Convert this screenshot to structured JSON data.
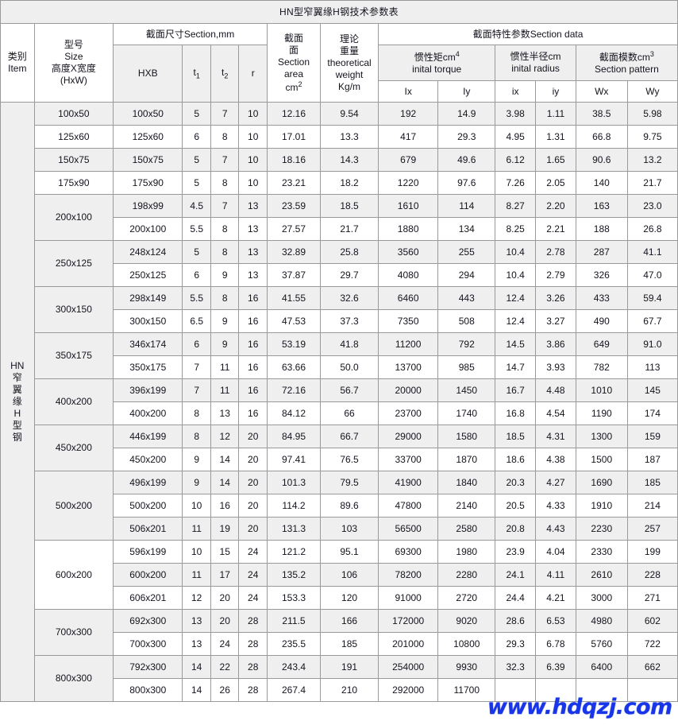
{
  "title": "HN型窄翼缘H钢技术参数表",
  "watermark": "www.hdqzj.com",
  "header": {
    "item": {
      "cn": "类别",
      "en": "Item"
    },
    "size": {
      "l1": "型号",
      "l2": "Size",
      "l3": "高度X宽度",
      "l4": "(HxW)"
    },
    "section_dim": "截面尺寸Section,mm",
    "hxb": "HXB",
    "t1": "t",
    "t1_sub": "1",
    "t2": "t",
    "t2_sub": "2",
    "r": "r",
    "section_area": {
      "l1": "截面",
      "l2": "面",
      "l3": "Section",
      "l4": "area",
      "l5": "cm",
      "sup": "2"
    },
    "theoretical_weight": {
      "l1": "理论",
      "l2": "重量",
      "l3": "theoretical",
      "l4": "weight",
      "l5": "Kg/m"
    },
    "section_data": "截面特性参数Section data",
    "inertia_torque": {
      "cn": "惯性矩cm",
      "sup": "4",
      "en": "inital torque"
    },
    "inertia_radius": {
      "cn": "惯性半径cm",
      "en": "inital radius"
    },
    "section_pattern": {
      "cn": "截面模数cm",
      "sup": "3",
      "en": "Section pattern"
    },
    "ix_moment": "Ix",
    "iy_moment": "Iy",
    "ix_radius": "ix",
    "iy_radius": "iy",
    "wx": "Wx",
    "wy": "Wy"
  },
  "category_label": [
    "HN",
    "窄",
    "翼",
    "缘",
    "H",
    "型",
    "钢"
  ],
  "colors": {
    "weight_red": "#e8112d",
    "header_gray": "#efefef",
    "border": "#9a9a9a",
    "watermark_blue": "#1835e8"
  },
  "groups": [
    {
      "size": "100x50",
      "rows": [
        {
          "hxb": "100x50",
          "t1": "5",
          "t2": "7",
          "r": "10",
          "area": "12.16",
          "weight": "9.54",
          "Ix": "192",
          "Iy": "14.9",
          "ix": "3.98",
          "iy": "1.11",
          "Wx": "38.5",
          "Wy": "5.98",
          "shade": "gray"
        }
      ]
    },
    {
      "size": "125x60",
      "rows": [
        {
          "hxb": "125x60",
          "t1": "6",
          "t2": "8",
          "r": "10",
          "area": "17.01",
          "weight": "13.3",
          "Ix": "417",
          "Iy": "29.3",
          "ix": "4.95",
          "iy": "1.31",
          "Wx": "66.8",
          "Wy": "9.75",
          "shade": "white"
        }
      ]
    },
    {
      "size": "150x75",
      "rows": [
        {
          "hxb": "150x75",
          "t1": "5",
          "t2": "7",
          "r": "10",
          "area": "18.16",
          "weight": "14.3",
          "Ix": "679",
          "Iy": "49.6",
          "ix": "6.12",
          "iy": "1.65",
          "Wx": "90.6",
          "Wy": "13.2",
          "shade": "gray"
        }
      ]
    },
    {
      "size": "175x90",
      "rows": [
        {
          "hxb": "175x90",
          "t1": "5",
          "t2": "8",
          "r": "10",
          "area": "23.21",
          "weight": "18.2",
          "Ix": "1220",
          "Iy": "97.6",
          "ix": "7.26",
          "iy": "2.05",
          "Wx": "140",
          "Wy": "21.7",
          "shade": "white"
        }
      ]
    },
    {
      "size": "200x100",
      "rows": [
        {
          "hxb": "198x99",
          "t1": "4.5",
          "t2": "7",
          "r": "13",
          "area": "23.59",
          "weight": "18.5",
          "Ix": "1610",
          "Iy": "114",
          "ix": "8.27",
          "iy": "2.20",
          "Wx": "163",
          "Wy": "23.0",
          "shade": "gray"
        },
        {
          "hxb": "200x100",
          "t1": "5.5",
          "t2": "8",
          "r": "13",
          "area": "27.57",
          "weight": "21.7",
          "Ix": "1880",
          "Iy": "134",
          "ix": "8.25",
          "iy": "2.21",
          "Wx": "188",
          "Wy": "26.8",
          "shade": "white"
        }
      ]
    },
    {
      "size": "250x125",
      "rows": [
        {
          "hxb": "248x124",
          "t1": "5",
          "t2": "8",
          "r": "13",
          "area": "32.89",
          "weight": "25.8",
          "Ix": "3560",
          "Iy": "255",
          "ix": "10.4",
          "iy": "2.78",
          "Wx": "287",
          "Wy": "41.1",
          "shade": "gray"
        },
        {
          "hxb": "250x125",
          "t1": "6",
          "t2": "9",
          "r": "13",
          "area": "37.87",
          "weight": "29.7",
          "Ix": "4080",
          "Iy": "294",
          "ix": "10.4",
          "iy": "2.79",
          "Wx": "326",
          "Wy": "47.0",
          "shade": "white"
        }
      ]
    },
    {
      "size": "300x150",
      "rows": [
        {
          "hxb": "298x149",
          "t1": "5.5",
          "t2": "8",
          "r": "16",
          "area": "41.55",
          "weight": "32.6",
          "Ix": "6460",
          "Iy": "443",
          "ix": "12.4",
          "iy": "3.26",
          "Wx": "433",
          "Wy": "59.4",
          "shade": "gray"
        },
        {
          "hxb": "300x150",
          "t1": "6.5",
          "t2": "9",
          "r": "16",
          "area": "47.53",
          "weight": "37.3",
          "Ix": "7350",
          "Iy": "508",
          "ix": "12.4",
          "iy": "3.27",
          "Wx": "490",
          "Wy": "67.7",
          "shade": "white"
        }
      ]
    },
    {
      "size": "350x175",
      "rows": [
        {
          "hxb": "346x174",
          "t1": "6",
          "t2": "9",
          "r": "16",
          "area": "53.19",
          "weight": "41.8",
          "Ix": "11200",
          "Iy": "792",
          "ix": "14.5",
          "iy": "3.86",
          "Wx": "649",
          "Wy": "91.0",
          "shade": "gray"
        },
        {
          "hxb": "350x175",
          "t1": "7",
          "t2": "11",
          "r": "16",
          "area": "63.66",
          "weight": "50.0",
          "Ix": "13700",
          "Iy": "985",
          "ix": "14.7",
          "iy": "3.93",
          "Wx": "782",
          "Wy": "113",
          "shade": "white"
        }
      ]
    },
    {
      "size": "400x200",
      "rows": [
        {
          "hxb": "396x199",
          "t1": "7",
          "t2": "11",
          "r": "16",
          "area": "72.16",
          "weight": "56.7",
          "Ix": "20000",
          "Iy": "1450",
          "ix": "16.7",
          "iy": "4.48",
          "Wx": "1010",
          "Wy": "145",
          "shade": "gray"
        },
        {
          "hxb": "400x200",
          "t1": "8",
          "t2": "13",
          "r": "16",
          "area": "84.12",
          "weight": "66",
          "Ix": "23700",
          "Iy": "1740",
          "ix": "16.8",
          "iy": "4.54",
          "Wx": "1190",
          "Wy": "174",
          "shade": "white"
        }
      ]
    },
    {
      "size": "450x200",
      "rows": [
        {
          "hxb": "446x199",
          "t1": "8",
          "t2": "12",
          "r": "20",
          "area": "84.95",
          "weight": "66.7",
          "Ix": "29000",
          "Iy": "1580",
          "ix": "18.5",
          "iy": "4.31",
          "Wx": "1300",
          "Wy": "159",
          "shade": "gray"
        },
        {
          "hxb": "450x200",
          "t1": "9",
          "t2": "14",
          "r": "20",
          "area": "97.41",
          "weight": "76.5",
          "Ix": "33700",
          "Iy": "1870",
          "ix": "18.6",
          "iy": "4.38",
          "Wx": "1500",
          "Wy": "187",
          "shade": "white"
        }
      ]
    },
    {
      "size": "500x200",
      "rows": [
        {
          "hxb": "496x199",
          "t1": "9",
          "t2": "14",
          "r": "20",
          "area": "101.3",
          "weight": "79.5",
          "Ix": "41900",
          "Iy": "1840",
          "ix": "20.3",
          "iy": "4.27",
          "Wx": "1690",
          "Wy": "185",
          "shade": "gray"
        },
        {
          "hxb": "500x200",
          "t1": "10",
          "t2": "16",
          "r": "20",
          "area": "114.2",
          "weight": "89.6",
          "Ix": "47800",
          "Iy": "2140",
          "ix": "20.5",
          "iy": "4.33",
          "Wx": "1910",
          "Wy": "214",
          "shade": "white"
        },
        {
          "hxb": "506x201",
          "t1": "11",
          "t2": "19",
          "r": "20",
          "area": "131.3",
          "weight": "103",
          "Ix": "56500",
          "Iy": "2580",
          "ix": "20.8",
          "iy": "4.43",
          "Wx": "2230",
          "Wy": "257",
          "shade": "gray"
        }
      ]
    },
    {
      "size": "600x200",
      "rows": [
        {
          "hxb": "596x199",
          "t1": "10",
          "t2": "15",
          "r": "24",
          "area": "121.2",
          "weight": "95.1",
          "Ix": "69300",
          "Iy": "1980",
          "ix": "23.9",
          "iy": "4.04",
          "Wx": "2330",
          "Wy": "199",
          "shade": "white"
        },
        {
          "hxb": "600x200",
          "t1": "11",
          "t2": "17",
          "r": "24",
          "area": "135.2",
          "weight": "106",
          "Ix": "78200",
          "Iy": "2280",
          "ix": "24.1",
          "iy": "4.11",
          "Wx": "2610",
          "Wy": "228",
          "shade": "gray"
        },
        {
          "hxb": "606x201",
          "t1": "12",
          "t2": "20",
          "r": "24",
          "area": "153.3",
          "weight": "120",
          "Ix": "91000",
          "Iy": "2720",
          "ix": "24.4",
          "iy": "4.21",
          "Wx": "3000",
          "Wy": "271",
          "shade": "white"
        }
      ]
    },
    {
      "size": "700x300",
      "rows": [
        {
          "hxb": "692x300",
          "t1": "13",
          "t2": "20",
          "r": "28",
          "area": "211.5",
          "weight": "166",
          "Ix": "172000",
          "Iy": "9020",
          "ix": "28.6",
          "iy": "6.53",
          "Wx": "4980",
          "Wy": "602",
          "shade": "gray"
        },
        {
          "hxb": "700x300",
          "t1": "13",
          "t2": "24",
          "r": "28",
          "area": "235.5",
          "weight": "185",
          "Ix": "201000",
          "Iy": "10800",
          "ix": "29.3",
          "iy": "6.78",
          "Wx": "5760",
          "Wy": "722",
          "shade": "white"
        }
      ]
    },
    {
      "size": "800x300",
      "rows": [
        {
          "hxb": "792x300",
          "t1": "14",
          "t2": "22",
          "r": "28",
          "area": "243.4",
          "weight": "191",
          "Ix": "254000",
          "Iy": "9930",
          "ix": "32.3",
          "iy": "6.39",
          "Wx": "6400",
          "Wy": "662",
          "shade": "gray"
        },
        {
          "hxb": "800x300",
          "t1": "14",
          "t2": "26",
          "r": "28",
          "area": "267.4",
          "weight": "210",
          "Ix": "292000",
          "Iy": "11700",
          "ix": "",
          "iy": "",
          "Wx": "",
          "Wy": "",
          "shade": "white"
        }
      ]
    }
  ]
}
